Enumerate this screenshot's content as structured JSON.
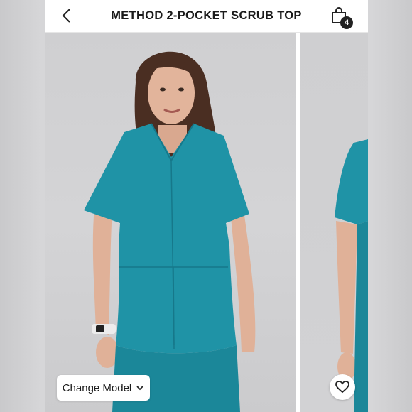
{
  "header": {
    "title": "METHOD 2-POCKET SCRUB TOP",
    "back_icon": "chevron-left-icon",
    "bag_icon": "shopping-bag-icon",
    "bag_count": "4"
  },
  "gallery": {
    "main_image": "model-wearing-teal-scrub-top",
    "next_image": "model-side-view-teal-scrub",
    "change_model_label": "Change Model",
    "change_model_icon": "chevron-down-icon",
    "favorite_icon": "heart-icon"
  },
  "colors": {
    "scrub_teal": "#1f93a6",
    "background": "#d3d3d5",
    "header_bg": "#ffffff",
    "badge_bg": "#222222"
  }
}
